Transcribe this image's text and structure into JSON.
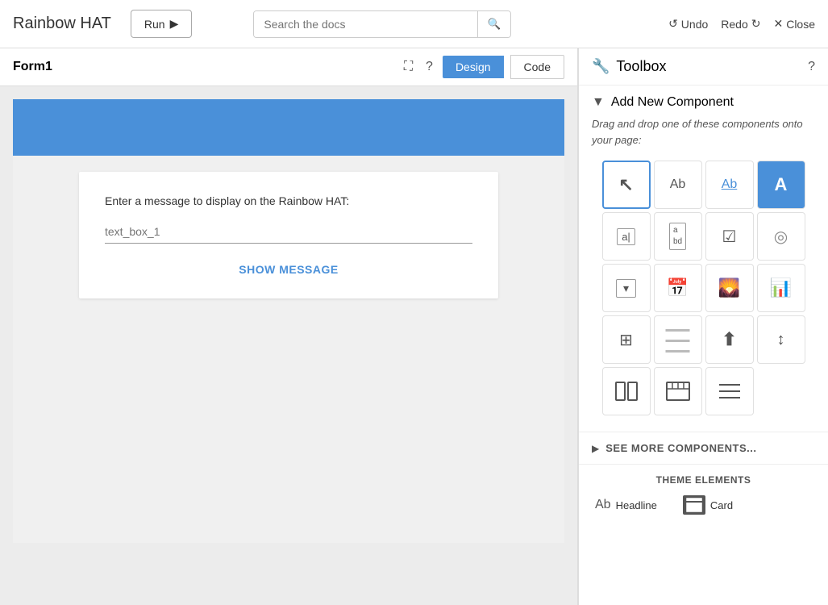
{
  "header": {
    "app_title": "Rainbow HAT",
    "run_label": "Run",
    "search_placeholder": "Search the docs",
    "undo_label": "Undo",
    "redo_label": "Redo",
    "close_label": "Close"
  },
  "form_panel": {
    "title": "Form1",
    "tab_design": "Design",
    "tab_code": "Code"
  },
  "canvas": {
    "label": "Enter a message to display on the Rainbow HAT:",
    "textbox_placeholder": "text_box_1",
    "button_label": "SHOW MESSAGE"
  },
  "toolbox": {
    "title": "Toolbox",
    "add_new_title": "Add New Component",
    "add_new_desc": "Drag and drop one of these components onto your page:",
    "see_more_label": "SEE MORE COMPONENTS...",
    "theme_title": "THEME ELEMENTS",
    "theme_headline_label": "Headline",
    "theme_card_label": "Card",
    "components": [
      {
        "id": "cursor",
        "label": "cursor"
      },
      {
        "id": "label",
        "label": "Label"
      },
      {
        "id": "label-link",
        "label": "Label Link"
      },
      {
        "id": "label-button",
        "label": "Label Button"
      },
      {
        "id": "textbox",
        "label": "TextBox"
      },
      {
        "id": "multiline",
        "label": "MultiLine"
      },
      {
        "id": "checkbox",
        "label": "CheckBox"
      },
      {
        "id": "radio",
        "label": "Radio"
      },
      {
        "id": "dropdown",
        "label": "DropDown"
      },
      {
        "id": "datepicker",
        "label": "DatePicker"
      },
      {
        "id": "image",
        "label": "Image"
      },
      {
        "id": "chart",
        "label": "Chart"
      },
      {
        "id": "datagrid",
        "label": "DataGrid"
      },
      {
        "id": "html",
        "label": "HTML"
      },
      {
        "id": "upload",
        "label": "Upload"
      },
      {
        "id": "spacer",
        "label": "Spacer"
      },
      {
        "id": "columns",
        "label": "Columns"
      },
      {
        "id": "nav",
        "label": "Navigation"
      },
      {
        "id": "list",
        "label": "List"
      }
    ]
  }
}
